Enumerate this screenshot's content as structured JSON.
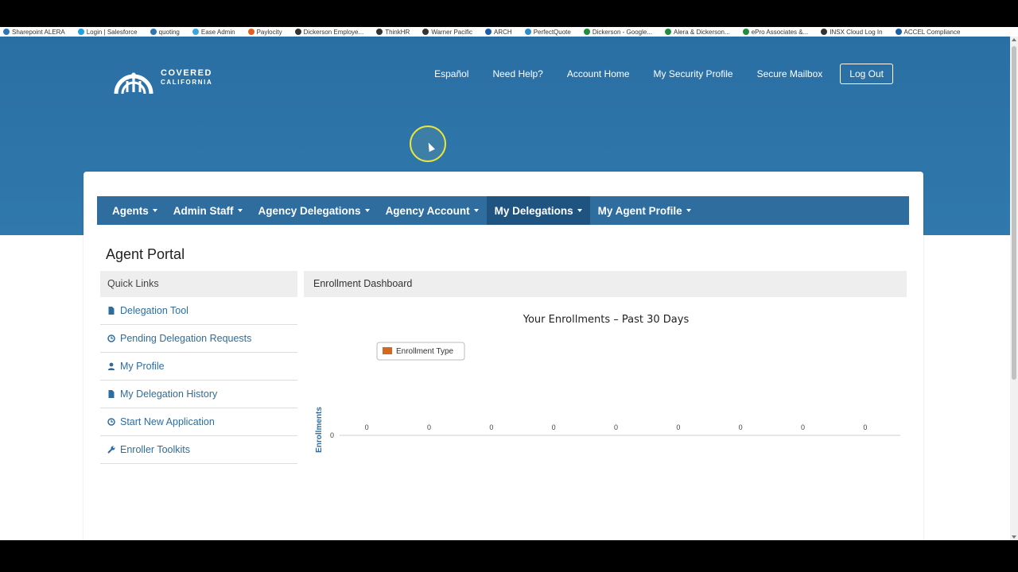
{
  "bookmarks": [
    {
      "label": "Sharepoint ALERA",
      "color": "#2e75b6"
    },
    {
      "label": "Login | Salesforce",
      "color": "#1fa0e0"
    },
    {
      "label": "quoting",
      "color": "#2e75b6"
    },
    {
      "label": "Ease Admin",
      "color": "#3aa7e0"
    },
    {
      "label": "Paylocity",
      "color": "#e06020"
    },
    {
      "label": "Dickerson Employe...",
      "color": "#333"
    },
    {
      "label": "ThinkHR",
      "color": "#333"
    },
    {
      "label": "Warner Pacific",
      "color": "#333"
    },
    {
      "label": "ARCH",
      "color": "#1a5da8"
    },
    {
      "label": "PerfectQuote",
      "color": "#2a8bd0"
    },
    {
      "label": "Dickerson - Google...",
      "color": "#1e8e3e"
    },
    {
      "label": "Alera & Dickerson...",
      "color": "#1e8e3e"
    },
    {
      "label": "ePro Associates &...",
      "color": "#1e8e3e"
    },
    {
      "label": "INSX Cloud Log In",
      "color": "#333"
    },
    {
      "label": "ACCEL Compliance",
      "color": "#1a5da8"
    }
  ],
  "logo": {
    "line1": "COVERED",
    "line2": "CALIFORNIA"
  },
  "topnav": {
    "links": [
      "Español",
      "Need Help?",
      "Account Home",
      "My Security Profile",
      "Secure Mailbox"
    ],
    "logout": "Log Out"
  },
  "mainnav": [
    {
      "label": "Agents",
      "active": false
    },
    {
      "label": "Admin Staff",
      "active": false
    },
    {
      "label": "Agency Delegations",
      "active": false
    },
    {
      "label": "Agency Account",
      "active": false
    },
    {
      "label": "My Delegations",
      "active": true
    },
    {
      "label": "My Agent Profile",
      "active": false
    }
  ],
  "page_title": "Agent Portal",
  "quick_links": {
    "title": "Quick Links",
    "items": [
      {
        "label": "Delegation Tool",
        "icon": "file-icon"
      },
      {
        "label": "Pending Delegation Requests",
        "icon": "clock-icon"
      },
      {
        "label": "My Profile",
        "icon": "user-icon"
      },
      {
        "label": "My Delegation History",
        "icon": "file-icon"
      },
      {
        "label": "Start New Application",
        "icon": "clock-icon"
      },
      {
        "label": "Enroller Toolkits",
        "icon": "wrench-icon"
      }
    ]
  },
  "dashboard": {
    "title": "Enrollment Dashboard"
  },
  "colors": {
    "brand_blue": "#2e75a9",
    "nav_blue": "#2e6d9e",
    "nav_active": "#1f5480",
    "series_orange": "#d2691e"
  },
  "chart_data": {
    "type": "bar",
    "title": "Your Enrollments – Past 30 Days",
    "ylabel": "Enrollments",
    "xlabel": "",
    "y_ticks": [
      "0"
    ],
    "series": [
      {
        "name": "Enrollment Type",
        "values": [
          0,
          0,
          0,
          0,
          0,
          0,
          0,
          0,
          0
        ]
      }
    ],
    "data_labels": [
      "0",
      "0",
      "0",
      "0",
      "0",
      "0",
      "0",
      "0",
      "0"
    ],
    "legend": "top-left",
    "grid": false
  }
}
